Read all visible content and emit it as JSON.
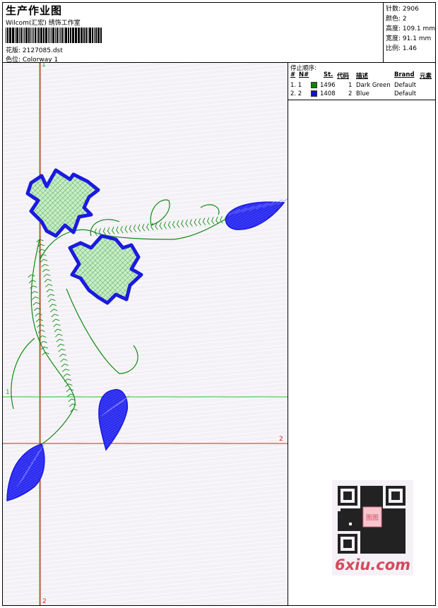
{
  "header": {
    "title": "生产作业图",
    "company": "Wilcom(汇宏) 绣饰工作室",
    "design_label": "花版: 2127085.dst",
    "color_label": "色位: Colorway 1"
  },
  "stats": {
    "stitches": "针数: 2906",
    "colors": "颜色: 2",
    "height": "高度: 109.1 mm",
    "width": "宽度: 91.1 mm",
    "ratio": "比例: 1.46"
  },
  "stop_sequence": {
    "title": "停止顺序:",
    "headers": [
      "#",
      "N#",
      "St.",
      "代码",
      "描述",
      "Brand",
      "元素"
    ],
    "rows": [
      {
        "idx": "1. 1",
        "color": "#108010",
        "stitches": "1496",
        "code": "1",
        "desc": "Dark Green",
        "brand": "Default"
      },
      {
        "idx": "2. 2",
        "color": "#1010dd",
        "stitches": "1408",
        "code": "2",
        "desc": "Blue",
        "brand": "Default"
      }
    ]
  },
  "axes": {
    "green_top": "1",
    "green_left": "1",
    "red_right": "2",
    "red_bottom": "2"
  },
  "watermark": {
    "site": "6xiu.com",
    "stamp": "图图"
  },
  "colors": {
    "green_thread": "#108a10",
    "blue_thread": "#1a1ae0",
    "leaf_fill": "#c8ecc8",
    "green_axis": "#22cc22",
    "red_axis": "#dd2222"
  }
}
